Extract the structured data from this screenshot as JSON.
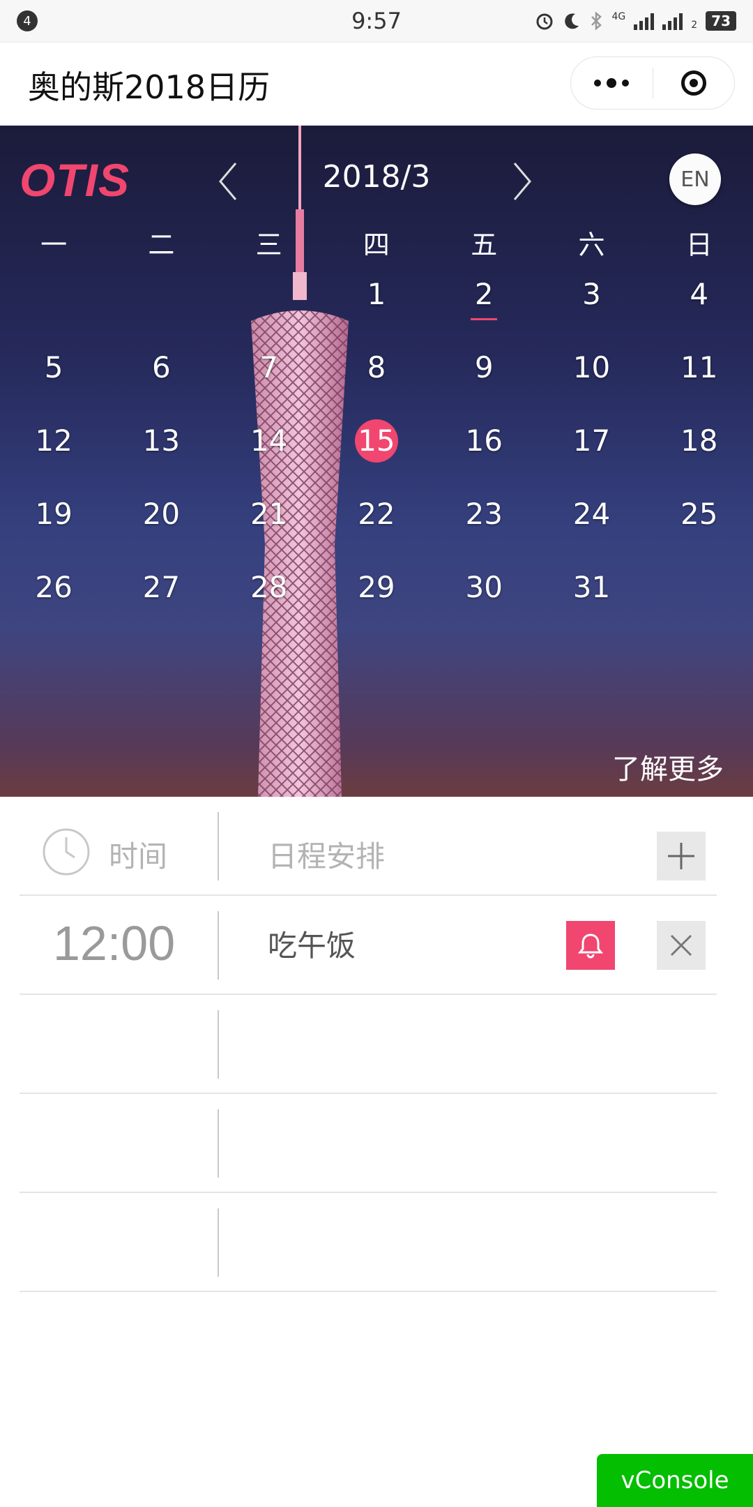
{
  "status_bar": {
    "notification_count": "4",
    "time": "9:57",
    "network": "4G",
    "sim2_label": "2",
    "battery": "73",
    "icons": [
      "alarm-icon",
      "moon-icon",
      "bluetooth-icon",
      "signal-icon"
    ]
  },
  "nav": {
    "title": "奥的斯2018日历"
  },
  "calendar": {
    "logo": "OTIS",
    "month_label": "2018/3",
    "lang_button": "EN",
    "weekdays": [
      "一",
      "二",
      "三",
      "四",
      "五",
      "六",
      "日"
    ],
    "leading_blanks": 3,
    "days": [
      "1",
      "2",
      "3",
      "4",
      "5",
      "6",
      "7",
      "8",
      "9",
      "10",
      "11",
      "12",
      "13",
      "14",
      "15",
      "16",
      "17",
      "18",
      "19",
      "20",
      "21",
      "22",
      "23",
      "24",
      "25",
      "26",
      "27",
      "28",
      "29",
      "30",
      "31"
    ],
    "today": "15",
    "marked_day": "2",
    "learn_more": "了解更多",
    "accent_color": "#f0466f"
  },
  "schedule": {
    "header_time": "时间",
    "header_schedule": "日程安排",
    "entries": [
      {
        "time": "12:00",
        "task": "吃午饭"
      }
    ],
    "empty_rows": 3
  },
  "vconsole": {
    "label": "vConsole",
    "color": "#04be02"
  }
}
